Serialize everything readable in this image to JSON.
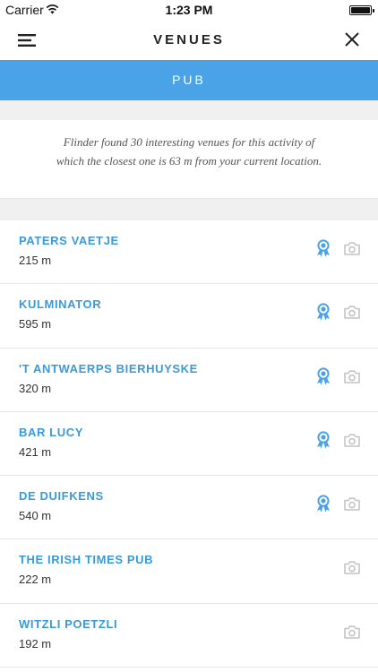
{
  "status_bar": {
    "carrier": "Carrier",
    "time": "1:23 PM"
  },
  "nav": {
    "title": "VENUES"
  },
  "banner": {
    "label": "PUB"
  },
  "info": {
    "text": "Flinder found 30 interesting venues for this activity of which the closest one is 63 m from your current location."
  },
  "colors": {
    "accent": "#4aa3e6",
    "link": "#3a9ad9",
    "icon_gray": "#c4c4c4"
  },
  "venues": [
    {
      "name": "PATERS VAETJE",
      "distance": "215 m",
      "awarded": true
    },
    {
      "name": "KULMINATOR",
      "distance": "595 m",
      "awarded": true
    },
    {
      "name": "'T ANTWAERPS BIERHUYSKE",
      "distance": "320 m",
      "awarded": true
    },
    {
      "name": "BAR LUCY",
      "distance": "421 m",
      "awarded": true
    },
    {
      "name": "DE DUIFKENS",
      "distance": "540 m",
      "awarded": true
    },
    {
      "name": "THE IRISH TIMES PUB",
      "distance": "222 m",
      "awarded": false
    },
    {
      "name": "WITZLI POETZLI",
      "distance": "192 m",
      "awarded": false
    }
  ]
}
